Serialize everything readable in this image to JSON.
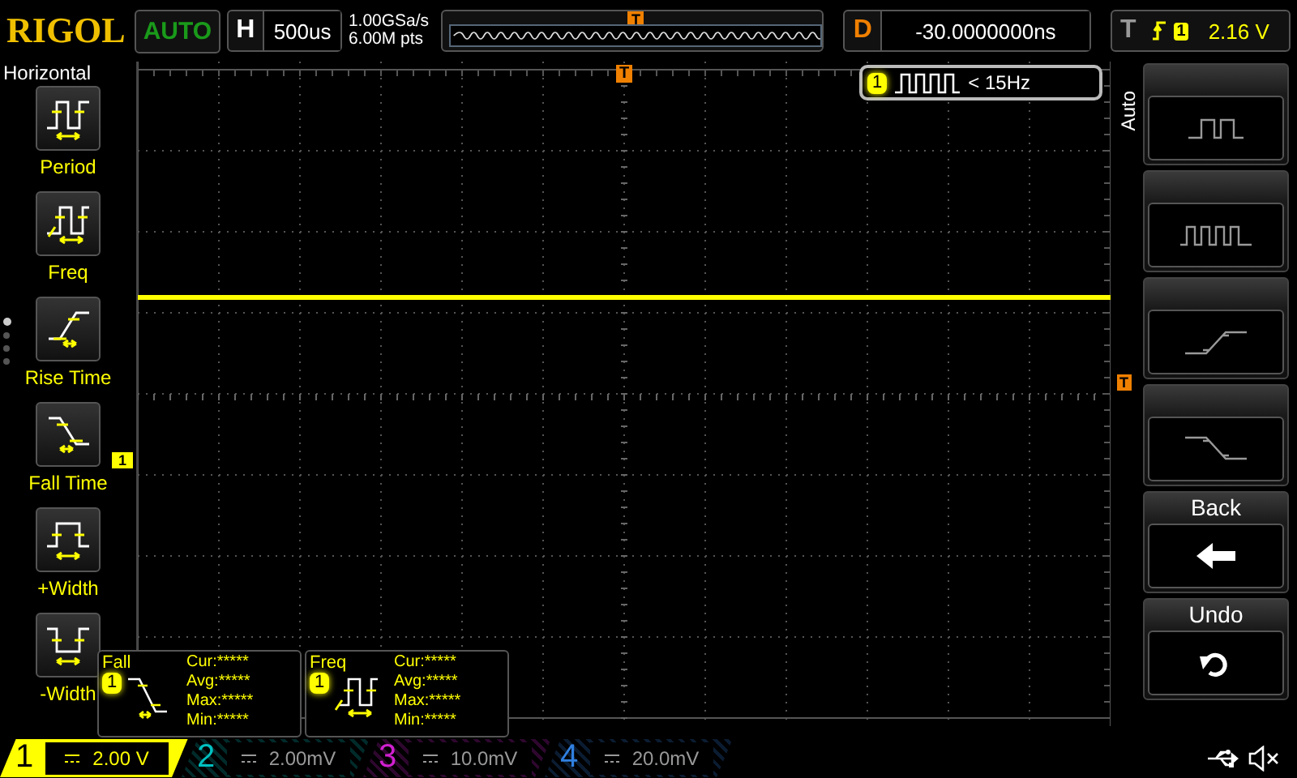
{
  "logo": "RIGOL",
  "run_status": "AUTO",
  "timebase": {
    "label": "H",
    "value": "500us"
  },
  "sample_rate": "1.00GSa/s",
  "memory_depth": "6.00M pts",
  "trigger_position_marker": "T",
  "delay": {
    "label": "D",
    "value": "-30.0000000ns"
  },
  "trigger": {
    "label": "T",
    "source": "1",
    "level": "2.16 V"
  },
  "left_menu": {
    "title": "Horizontal",
    "items": [
      {
        "label": "Period",
        "kind": "period"
      },
      {
        "label": "Freq",
        "kind": "freq"
      },
      {
        "label": "Rise Time",
        "kind": "rise"
      },
      {
        "label": "Fall Time",
        "kind": "fall"
      },
      {
        "label": "+Width",
        "kind": "pwidth"
      },
      {
        "label": "-Width",
        "kind": "nwidth"
      }
    ],
    "pages": [
      {
        "selected": true
      },
      {
        "selected": false
      },
      {
        "selected": false
      },
      {
        "selected": false
      }
    ]
  },
  "screen": {
    "top_trigger_marker": "T",
    "channel_marker": "1",
    "trigger_level_marker": "T",
    "freq_readout": {
      "channel": "1",
      "text": "< 15Hz"
    },
    "measurements": [
      {
        "title": "Fall",
        "channel": "1",
        "kind": "fall",
        "lines": [
          "Cur:*****",
          "Avg:*****",
          "Max:*****",
          "Min:*****"
        ]
      },
      {
        "title": "Freq",
        "channel": "1",
        "kind": "freq",
        "lines": [
          "Cur:*****",
          "Avg:*****",
          "Max:*****",
          "Min:*****"
        ]
      }
    ]
  },
  "right_menu": {
    "title": "Auto",
    "items": [
      {
        "kind": "slow_square"
      },
      {
        "kind": "fast_square"
      },
      {
        "kind": "rise"
      },
      {
        "kind": "fall"
      },
      {
        "kind": "back",
        "label": "Back"
      },
      {
        "kind": "undo",
        "label": "Undo"
      }
    ]
  },
  "channels": [
    {
      "number": "1",
      "scale": "2.00 V",
      "active": true,
      "color": "#ffff00"
    },
    {
      "number": "2",
      "scale": "2.00mV",
      "active": false,
      "color": "#00c0c0"
    },
    {
      "number": "3",
      "scale": "10.0mV",
      "active": false,
      "color": "#d020d0"
    },
    {
      "number": "4",
      "scale": "20.0mV",
      "active": false,
      "color": "#3080e0"
    }
  ]
}
